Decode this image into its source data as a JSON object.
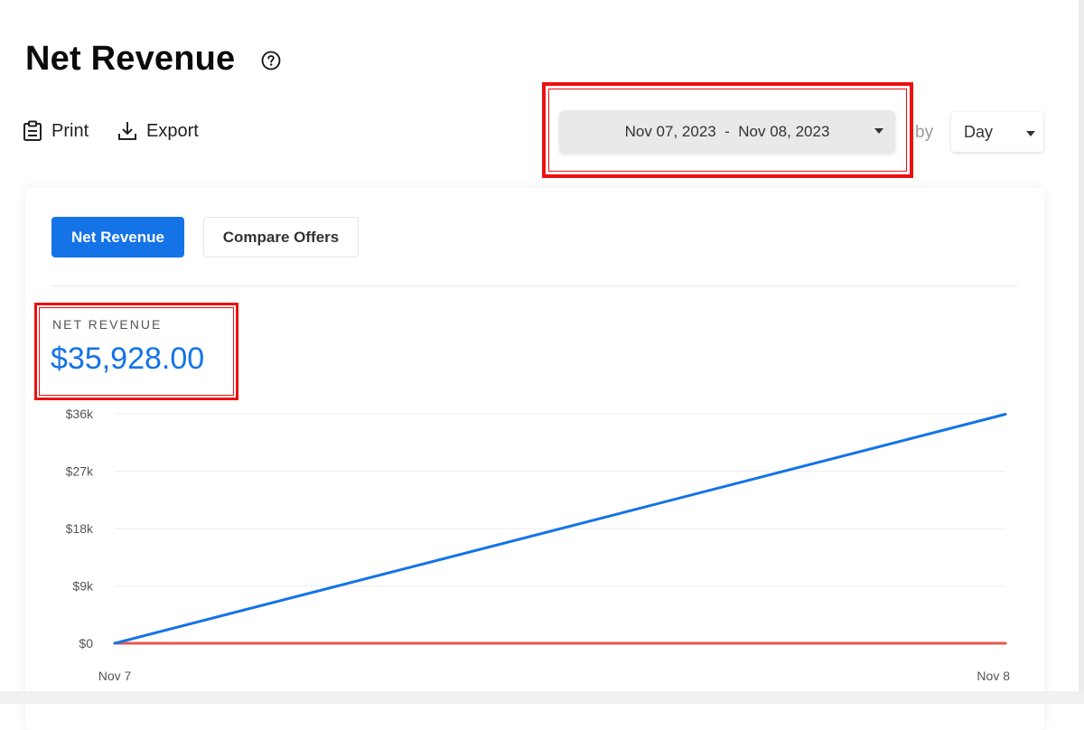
{
  "header": {
    "title": "Net Revenue",
    "help_icon": "question-circle-icon"
  },
  "toolbar": {
    "print_label": "Print",
    "print_icon": "clipboard-icon",
    "export_label": "Export",
    "export_icon": "download-icon",
    "date_range": "Nov 07, 2023  -  Nov 08, 2023",
    "group_by_label": "by",
    "granularity": "Day"
  },
  "tabs": [
    {
      "label": "Net Revenue",
      "active": true
    },
    {
      "label": "Compare Offers",
      "active": false
    }
  ],
  "metric": {
    "label": "NET REVENUE",
    "value": "$35,928.00"
  },
  "colors": {
    "accent": "#1473e6",
    "highlight": "#ec1010",
    "compare_series": "#e05a4f"
  },
  "chart_data": {
    "type": "line",
    "x": [
      "Nov 7",
      "Nov 8"
    ],
    "series": [
      {
        "values": [
          0,
          35928
        ],
        "color": "#1473e6"
      },
      {
        "values": [
          0,
          0
        ],
        "color": "#e05a4f"
      }
    ],
    "y_ticks": [
      "$0",
      "$9k",
      "$18k",
      "$27k",
      "$36k"
    ],
    "y_tick_values": [
      0,
      9000,
      18000,
      27000,
      36000
    ],
    "ylim": [
      0,
      36000
    ],
    "grid": true
  }
}
